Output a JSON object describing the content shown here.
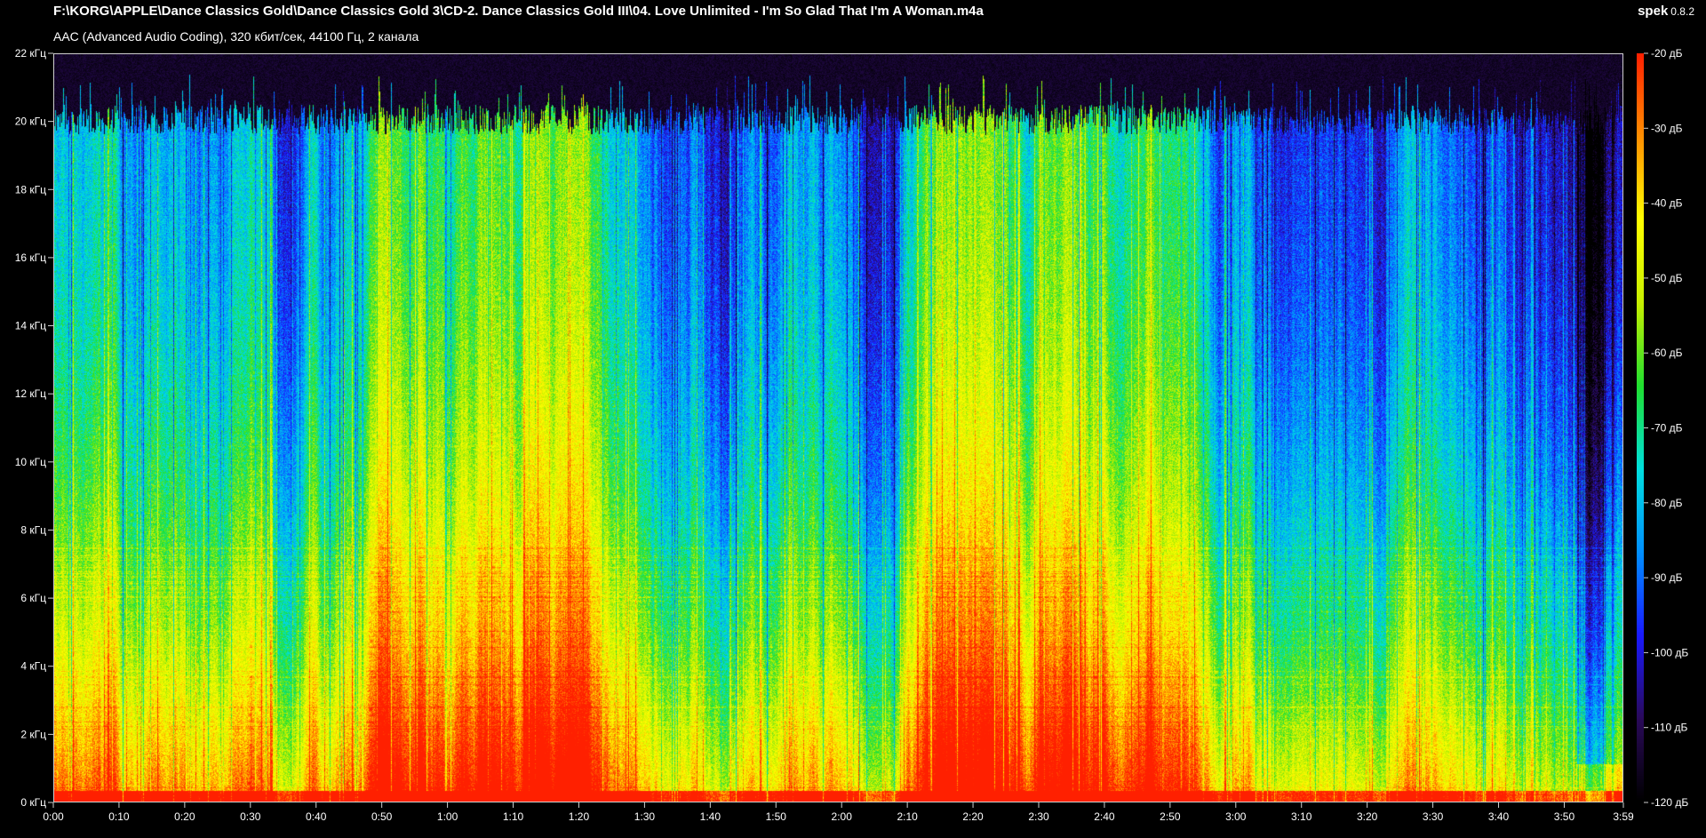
{
  "window": {
    "title": "F:\\KORG\\APPLE\\Dance Classics Gold\\Dance Classics Gold 3\\CD-2. Dance Classics Gold III\\04. Love Unlimited - I'm So Glad That I'm A Woman.m4a",
    "subtitle": "AAC (Advanced Audio Coding), 320 кбит/сек, 44100 Гц, 2 канала",
    "app_name": "spek",
    "app_version": "0.8.2"
  },
  "chart_data": {
    "type": "heatmap",
    "title": "F:\\KORG\\APPLE\\Dance Classics Gold\\Dance Classics Gold 3\\CD-2. Dance Classics Gold III\\04. Love Unlimited - I'm So Glad That I'm A Woman.m4a",
    "subtitle": "AAC (Advanced Audio Coding), 320 кбит/сек, 44100 Гц, 2 канала",
    "x": {
      "range_seconds": [
        0,
        239
      ],
      "tick_labels": [
        "0:00",
        "0:10",
        "0:20",
        "0:30",
        "0:40",
        "0:50",
        "1:00",
        "1:10",
        "1:20",
        "1:30",
        "1:40",
        "1:50",
        "2:00",
        "2:10",
        "2:20",
        "2:30",
        "2:40",
        "2:50",
        "3:00",
        "3:10",
        "3:20",
        "3:30",
        "3:40",
        "3:50",
        "3:59"
      ],
      "tick_values_seconds": [
        0,
        10,
        20,
        30,
        40,
        50,
        60,
        70,
        80,
        90,
        100,
        110,
        120,
        130,
        140,
        150,
        160,
        170,
        180,
        190,
        200,
        210,
        220,
        230,
        239
      ]
    },
    "y": {
      "range_khz": [
        0,
        22
      ],
      "tick_labels": [
        "0 кГц",
        "2 кГц",
        "4 кГц",
        "6 кГц",
        "8 кГц",
        "10 кГц",
        "12 кГц",
        "14 кГц",
        "16 кГц",
        "18 кГц",
        "20 кГц",
        "22 кГц"
      ],
      "tick_values_khz": [
        0,
        2,
        4,
        6,
        8,
        10,
        12,
        14,
        16,
        18,
        20,
        22
      ]
    },
    "colorbar": {
      "range_db": [
        -120,
        -20
      ],
      "tick_labels": [
        "-20 дБ",
        "-30 дБ",
        "-40 дБ",
        "-50 дБ",
        "-60 дБ",
        "-70 дБ",
        "-80 дБ",
        "-90 дБ",
        "-100 дБ",
        "-110 дБ",
        "-120 дБ"
      ],
      "tick_values_db": [
        -20,
        -30,
        -40,
        -50,
        -60,
        -70,
        -80,
        -90,
        -100,
        -110,
        -120
      ],
      "colors": [
        "#000000",
        "#2a0a5a",
        "#1a1aff",
        "#0090ff",
        "#00e0e0",
        "#20e030",
        "#c8f000",
        "#ffff00",
        "#ff9000",
        "#ff2000"
      ]
    },
    "cutoff_khz": 20.5,
    "grid": false
  }
}
